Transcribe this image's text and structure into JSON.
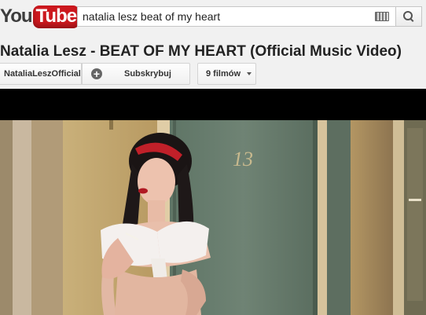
{
  "logo": {
    "part1": "You",
    "part2": "Tube"
  },
  "search": {
    "query": "natalia lesz beat of my heart"
  },
  "video": {
    "title": "Natalia Lesz - BEAT OF MY HEART (Official Music Video)",
    "channel": "NataliaLeszOfficial",
    "subscribe_label": "Subskrybuj",
    "playlist_label": "9 filmów",
    "door_number": "13"
  },
  "icons": [
    "keyboard-icon",
    "search-icon",
    "plus-icon",
    "caret-down-icon"
  ],
  "colors": {
    "brand_red": "#cc181e",
    "background": "#f1f1f1",
    "text": "#222222"
  }
}
